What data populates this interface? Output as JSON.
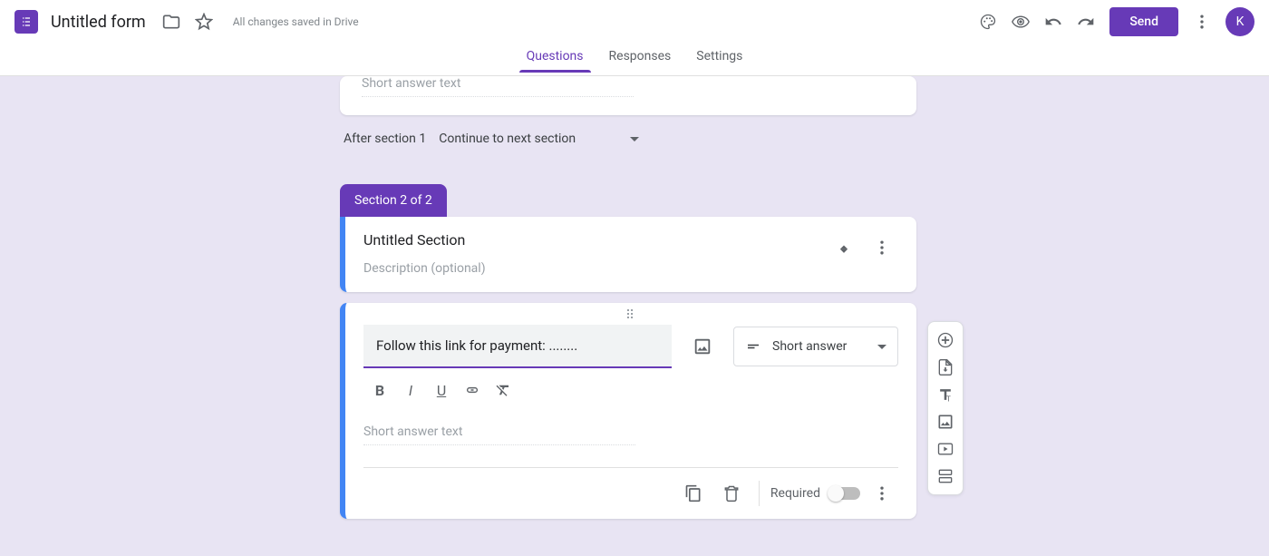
{
  "header": {
    "form_title": "Untitled form",
    "saved_text": "All changes saved in Drive",
    "send_label": "Send",
    "avatar_letter": "K",
    "tabs": [
      "Questions",
      "Responses",
      "Settings"
    ]
  },
  "top_question": {
    "answer_placeholder": "Short answer text"
  },
  "after_section": {
    "label": "After section 1",
    "action": "Continue to next section"
  },
  "section_badge": "Section 2 of 2",
  "section_header": {
    "title": "Untitled Section",
    "description_placeholder": "Description (optional)"
  },
  "active_question": {
    "text": "Follow this link for payment: ........",
    "type_label": "Short answer",
    "answer_placeholder": "Short answer text",
    "required_label": "Required"
  },
  "colors": {
    "accent": "#673ab7",
    "focus": "#4285f4",
    "background": "#e8e4f3"
  }
}
